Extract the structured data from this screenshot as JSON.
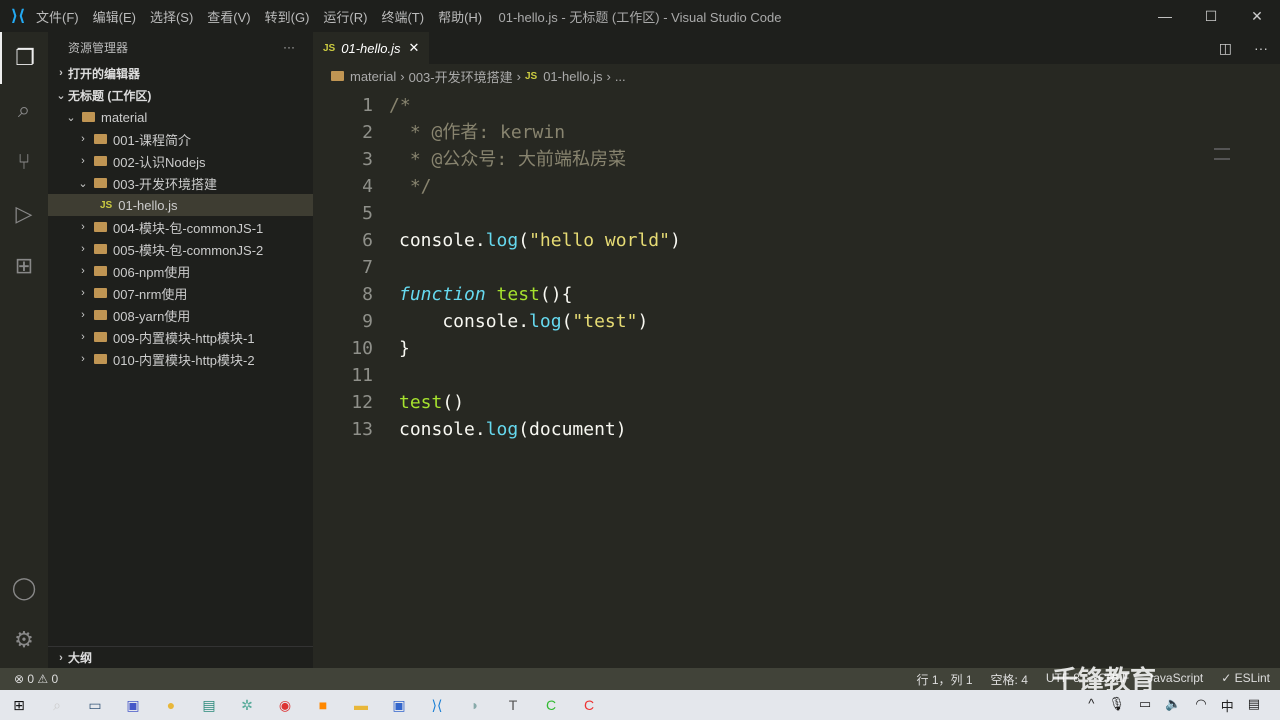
{
  "window": {
    "title": "01-hello.js - 无标题 (工作区) - Visual Studio Code",
    "minimize": "—",
    "maximize": "☐",
    "close": "✕"
  },
  "menu": [
    "文件(F)",
    "编辑(E)",
    "选择(S)",
    "查看(V)",
    "转到(G)",
    "运行(R)",
    "终端(T)",
    "帮助(H)"
  ],
  "sidebar": {
    "title": "资源管理器",
    "more": "···",
    "open_editors": "打开的编辑器",
    "workspace": "无标题 (工作区)",
    "root": "material",
    "items": [
      {
        "label": "001-课程简介",
        "type": "folder",
        "expanded": false
      },
      {
        "label": "002-认识Nodejs",
        "type": "folder",
        "expanded": false
      },
      {
        "label": "003-开发环境搭建",
        "type": "folder",
        "expanded": true
      },
      {
        "label": "01-hello.js",
        "type": "file",
        "selected": true
      },
      {
        "label": "004-模块-包-commonJS-1",
        "type": "folder",
        "expanded": false
      },
      {
        "label": "005-模块-包-commonJS-2",
        "type": "folder",
        "expanded": false
      },
      {
        "label": "006-npm使用",
        "type": "folder",
        "expanded": false
      },
      {
        "label": "007-nrm使用",
        "type": "folder",
        "expanded": false
      },
      {
        "label": "008-yarn使用",
        "type": "folder",
        "expanded": false
      },
      {
        "label": "009-内置模块-http模块-1",
        "type": "folder",
        "expanded": false
      },
      {
        "label": "010-内置模块-http模块-2",
        "type": "folder",
        "expanded": false
      }
    ],
    "outline": "大纲"
  },
  "tab": {
    "icon": "JS",
    "name": "01-hello.js",
    "close": "✕"
  },
  "breadcrumb": [
    "material",
    "003-开发环境搭建",
    "01-hello.js",
    "..."
  ],
  "code": [
    [
      [
        "c",
        "/*"
      ]
    ],
    [
      [
        "c",
        " * @作者: kerwin"
      ]
    ],
    [
      [
        "c",
        " * @公众号: 大前端私房菜"
      ]
    ],
    [
      [
        "c",
        " */"
      ]
    ],
    [],
    [
      [
        "p",
        "console."
      ],
      [
        "f",
        "log"
      ],
      [
        "p",
        "("
      ],
      [
        "s",
        "\"hello world\""
      ],
      [
        "p",
        ")"
      ]
    ],
    [],
    [
      [
        "k",
        "function"
      ],
      [
        "p",
        " "
      ],
      [
        "n",
        "test"
      ],
      [
        "p",
        "(){"
      ]
    ],
    [
      [
        "p",
        "    console."
      ],
      [
        "f",
        "log"
      ],
      [
        "p",
        "("
      ],
      [
        "s",
        "\"test\""
      ],
      [
        "p",
        ")"
      ]
    ],
    [
      [
        "p",
        "}"
      ]
    ],
    [],
    [
      [
        "n",
        "test"
      ],
      [
        "p",
        "()"
      ]
    ],
    [
      [
        "p",
        "console."
      ],
      [
        "f",
        "log"
      ],
      [
        "p",
        "(document)"
      ]
    ]
  ],
  "status": {
    "errors": "⊗ 0",
    "warnings": "⚠ 0",
    "position": "行 1，列 1",
    "spaces": "空格: 4",
    "encoding": "UTF-8",
    "eol": "CRLF",
    "language": "JavaScript",
    "eslint": "✓ ESLint"
  },
  "watermark": "千锋教育",
  "taskbar": {
    "ime": "中"
  }
}
